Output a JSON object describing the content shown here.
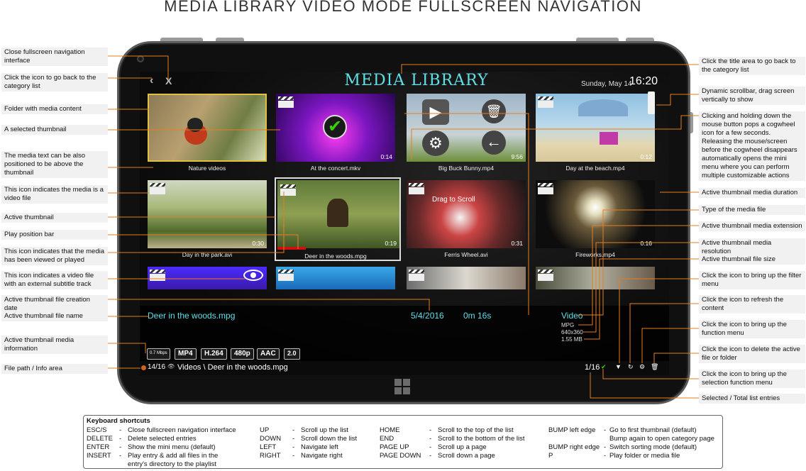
{
  "page_title": "MEDIA LIBRARY VIDEO MODE FULLSCREEN NAVIGATION",
  "screen": {
    "back_icon": "‹",
    "close_icon": "X",
    "title": "MEDIA LIBRARY",
    "date": "Sunday, May 14",
    "time": "16:20"
  },
  "thumbnails": [
    {
      "caption": "Nature videos",
      "duration": "",
      "folder": true
    },
    {
      "caption": "At the concert.mkv",
      "duration": "0:14"
    },
    {
      "caption": "Big Buck Bunny.mp4",
      "duration": "9:56"
    },
    {
      "caption": "Day at the beach.mp4",
      "duration": "0:12"
    },
    {
      "caption": "Day in the park.avi",
      "duration": "0:30"
    },
    {
      "caption": "Deer in the woods.mpg",
      "duration": "0:19"
    },
    {
      "caption": "Ferris Wheel.avi",
      "duration": "0:31"
    },
    {
      "caption": "Fireworks.mp4",
      "duration": "0:16"
    },
    {
      "caption": "",
      "duration": ""
    },
    {
      "caption": "",
      "duration": ""
    },
    {
      "caption": "",
      "duration": ""
    },
    {
      "caption": "",
      "duration": ""
    }
  ],
  "drag_to_scroll": "Drag to Scroll",
  "active": {
    "filename": "Deer in the woods.mpg",
    "creation_date": "5/4/2016",
    "duration": "0m 16s",
    "type": "Video",
    "extension": "MPG",
    "resolution": "640x360",
    "size": "1.55 MB",
    "badges": [
      "0.7 Mbps",
      "MP4",
      "H.264",
      "480p",
      "AAC",
      "2.0"
    ]
  },
  "path": {
    "position": "14/16",
    "text": "Videos \\ Deer in the woods.mpg",
    "count": "1/16"
  },
  "left_labels": [
    "Close fullscreen navigation interface",
    "Click the icon to go back to the category list",
    "Folder with media content",
    "A selected thumbnail",
    "The media text can be also positioned to be above the thumbnail",
    "This icon indicates the media is a video file",
    "Active thumbnail",
    "Play position bar",
    "This icon indicates that the media has been viewed or played",
    "This icon indicates a video file with an external subtitle track",
    "Active thumbnail file creation date",
    "Active thumbnail file name",
    "Active thumbnail media information",
    "File path / Info area"
  ],
  "right_labels": [
    "Click the title area to go back to the category list",
    "Dynamic scrollbar, drag screen vertically to show",
    "Clicking and holding down the mouse button pops a cogwheel icon for a few seconds. Releasing the mouse/screen before the cogwheel disappears automatically opens the mini menu where you can perform multiple customizable actions",
    "Active thumbnail media duration",
    "Type of the media file",
    "Active thumbnail media extension",
    "Active thumbnail media resolution",
    "Active thumbnail file size",
    "Click the icon to bring up the filter menu",
    "Click the icon to refresh the content",
    "Click the icon to bring up the function menu",
    "Click the icon to delete the active file or folder",
    "Click the icon to bring up the selection function menu",
    "Selected / Total list entries"
  ],
  "shortcuts": {
    "title": "Keyboard shortcuts",
    "col1": [
      {
        "key": "ESC/S",
        "desc": "Close fullscreen navigation interface"
      },
      {
        "key": "DELETE",
        "desc": "Delete selected entries"
      },
      {
        "key": "ENTER",
        "desc": "Show the mini menu (default)"
      },
      {
        "key": "INSERT",
        "desc": "Play entry & add all files in the"
      },
      {
        "key": "",
        "desc": "entry's directory to the playlist"
      }
    ],
    "col2": [
      {
        "key": "UP",
        "desc": "Scroll up the list"
      },
      {
        "key": "DOWN",
        "desc": "Scroll down the list"
      },
      {
        "key": "LEFT",
        "desc": "Navigate left"
      },
      {
        "key": "RIGHT",
        "desc": "Navigate right"
      }
    ],
    "col3": [
      {
        "key": "HOME",
        "desc": "Scroll to the top of the list"
      },
      {
        "key": "END",
        "desc": "Scroll to the bottom of the list"
      },
      {
        "key": "PAGE UP",
        "desc": "Scroll up a page"
      },
      {
        "key": "PAGE DOWN",
        "desc": "Scroll down a page"
      }
    ],
    "col4": [
      {
        "key": "BUMP left edge",
        "desc": "Go to first thumbnail (default)"
      },
      {
        "key": "",
        "desc": "Bump again to open category page"
      },
      {
        "key": "BUMP right edge",
        "desc": "Switch sorting mode (default)"
      },
      {
        "key": "P",
        "desc": "Play folder or media file"
      }
    ]
  },
  "colors": {
    "accent_cyan": "#5fe0e8",
    "play_bar_red": "#d01010",
    "selected_border": "#e0c040",
    "label_bg": "#f1f1f1",
    "leader_line": "#e67e22"
  }
}
